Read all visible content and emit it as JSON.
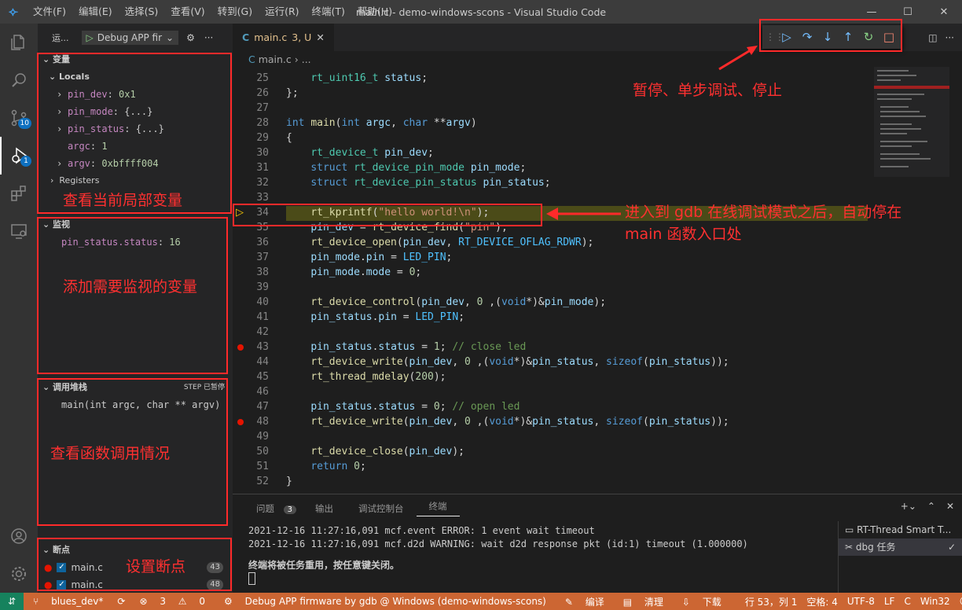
{
  "titlebar": {
    "logo": "vscode-logo",
    "menu": [
      "文件(F)",
      "编辑(E)",
      "选择(S)",
      "查看(V)",
      "转到(G)",
      "运行(R)",
      "终端(T)",
      "帮助(H)"
    ],
    "title": "main.c - demo-windows-scons - Visual Studio Code",
    "min": "—",
    "max": "☐",
    "close": "✕"
  },
  "activity": {
    "badges": {
      "scm": "10",
      "debug": "1"
    }
  },
  "sidebar": {
    "header": "运...",
    "config_name": "Debug APP fir",
    "variables_title": "变量",
    "locals_label": "Locals",
    "variables": [
      {
        "name": "pin_dev",
        "value": "0x1",
        "expandable": true
      },
      {
        "name": "pin_mode",
        "value": "{...}",
        "expandable": true
      },
      {
        "name": "pin_status",
        "value": "{...}",
        "expandable": true
      },
      {
        "name": "argc",
        "value": "1",
        "expandable": false
      },
      {
        "name": "argv",
        "value": "0xbffff004",
        "expandable": true
      }
    ],
    "registers_label": "Registers",
    "watch_title": "监视",
    "watch_items": [
      {
        "name": "pin_status.status",
        "value": "16"
      }
    ],
    "callstack_title": "调用堆栈",
    "callstack_status": "STEP 已暂停",
    "callstack_frames": [
      "main(int argc, char ** argv)"
    ],
    "breakpoints_title": "断点",
    "breakpoints": [
      {
        "file": "main.c",
        "line": "43"
      },
      {
        "file": "main.c",
        "line": "48"
      }
    ]
  },
  "annotations": {
    "variables": "查看当前局部变量",
    "watch": "添加需要监视的变量",
    "callstack": "查看函数调用情况",
    "breakpoints": "设置断点",
    "toolbar": "暂停、单步调试、停止",
    "stopline_1": "进入到 gdb 在线调试模式之后，自动停在",
    "stopline_2": "main 函数入口处"
  },
  "editor": {
    "tab_label": "main.c",
    "tab_status": "3, U",
    "breadcrumb_file": "main.c",
    "breadcrumb_rest": "...",
    "current_line": "34",
    "breakpoint_lines": [
      "43",
      "48"
    ],
    "lines": [
      {
        "n": "25",
        "html": "    <span class='ty'>rt_uint16_t</span> <span class='va'>status</span>;"
      },
      {
        "n": "26",
        "html": "};"
      },
      {
        "n": "27",
        "html": ""
      },
      {
        "n": "28",
        "html": "<span class='kw'>int</span> <span class='fn'>main</span>(<span class='kw'>int</span> <span class='va'>argc</span>, <span class='kw'>char</span> **<span class='va'>argv</span>)"
      },
      {
        "n": "29",
        "html": "{"
      },
      {
        "n": "30",
        "html": "    <span class='ty'>rt_device_t</span> <span class='va'>pin_dev</span>;"
      },
      {
        "n": "31",
        "html": "    <span class='kw'>struct</span> <span class='ty'>rt_device_pin_mode</span> <span class='va'>pin_mode</span>;"
      },
      {
        "n": "32",
        "html": "    <span class='kw'>struct</span> <span class='ty'>rt_device_pin_status</span> <span class='va'>pin_status</span>;"
      },
      {
        "n": "33",
        "html": ""
      },
      {
        "n": "34",
        "html": "    <span class='fn'>rt_kprintf</span>(<span class='st'>\"hello world!\\n\"</span>);"
      },
      {
        "n": "35",
        "html": "    <span class='va'>pin_dev</span> = <span class='fn'>rt_device_find</span>(<span class='st'>\"pin\"</span>);"
      },
      {
        "n": "36",
        "html": "    <span class='fn'>rt_device_open</span>(<span class='va'>pin_dev</span>, <span class='cn'>RT_DEVICE_OFLAG_RDWR</span>);"
      },
      {
        "n": "37",
        "html": "    <span class='va'>pin_mode</span>.<span class='va'>pin</span> = <span class='cn'>LED_PIN</span>;"
      },
      {
        "n": "38",
        "html": "    <span class='va'>pin_mode</span>.<span class='va'>mode</span> = <span class='nu'>0</span>;"
      },
      {
        "n": "39",
        "html": ""
      },
      {
        "n": "40",
        "html": "    <span class='fn'>rt_device_control</span>(<span class='va'>pin_dev</span>, <span class='nu'>0</span> ,(<span class='kw'>void</span>*)&amp;<span class='va'>pin_mode</span>);"
      },
      {
        "n": "41",
        "html": "    <span class='va'>pin_status</span>.<span class='va'>pin</span> = <span class='cn'>LED_PIN</span>;"
      },
      {
        "n": "42",
        "html": ""
      },
      {
        "n": "43",
        "html": "    <span class='va'>pin_status</span>.<span class='va'>status</span> = <span class='nu'>1</span>; <span class='cm'>// close led</span>"
      },
      {
        "n": "44",
        "html": "    <span class='fn'>rt_device_write</span>(<span class='va'>pin_dev</span>, <span class='nu'>0</span> ,(<span class='kw'>void</span>*)&amp;<span class='va'>pin_status</span>, <span class='kw'>sizeof</span>(<span class='va'>pin_status</span>));"
      },
      {
        "n": "45",
        "html": "    <span class='fn'>rt_thread_mdelay</span>(<span class='nu'>200</span>);"
      },
      {
        "n": "46",
        "html": ""
      },
      {
        "n": "47",
        "html": "    <span class='va'>pin_status</span>.<span class='va'>status</span> = <span class='nu'>0</span>; <span class='cm'>// open led</span>"
      },
      {
        "n": "48",
        "html": "    <span class='fn'>rt_device_write</span>(<span class='va'>pin_dev</span>, <span class='nu'>0</span> ,(<span class='kw'>void</span>*)&amp;<span class='va'>pin_status</span>, <span class='kw'>sizeof</span>(<span class='va'>pin_status</span>));"
      },
      {
        "n": "49",
        "html": ""
      },
      {
        "n": "50",
        "html": "    <span class='fn'>rt_device_close</span>(<span class='va'>pin_dev</span>);"
      },
      {
        "n": "51",
        "html": "    <span class='kw'>return</span> <span class='nu'>0</span>;"
      },
      {
        "n": "52",
        "html": "}"
      }
    ]
  },
  "panel": {
    "tabs": [
      {
        "label": "问题",
        "badge": "3"
      },
      {
        "label": "输出"
      },
      {
        "label": "调试控制台"
      },
      {
        "label": "终端",
        "active": true
      }
    ],
    "terminal_lines": [
      "2021-12-16 11:27:16,091 mcf.event ERROR: 1 event wait timeout",
      "2021-12-16 11:27:16,091 mcf.d2d WARNING: wait d2d response pkt (id:1) timeout (1.000000)"
    ],
    "terminal_notice": "终端将被任务重用，按任意键关闭。",
    "terminal_list": [
      {
        "label": "RT-Thread Smart T...",
        "icon": "terminal-icon"
      },
      {
        "label": "dbg 任务",
        "icon": "tools-icon"
      }
    ]
  },
  "statusbar": {
    "remote": "⇵",
    "branch": "blues_dev*",
    "sync": "⟳",
    "errors": "3",
    "warnings": "0",
    "debug_target": "Debug APP firmware by gdb @ Windows (demo-windows-scons)",
    "build": "编译",
    "clean": "清理",
    "download": "下载",
    "position": "行 53，列 1",
    "spaces": "空格: 4",
    "encoding": "UTF-8",
    "eol": "LF",
    "language": "C",
    "platform": "Win32"
  },
  "colors": {
    "statusbar": "#cc6633",
    "annotation": "#ff2a2a",
    "debug_icon": "#75beff"
  }
}
